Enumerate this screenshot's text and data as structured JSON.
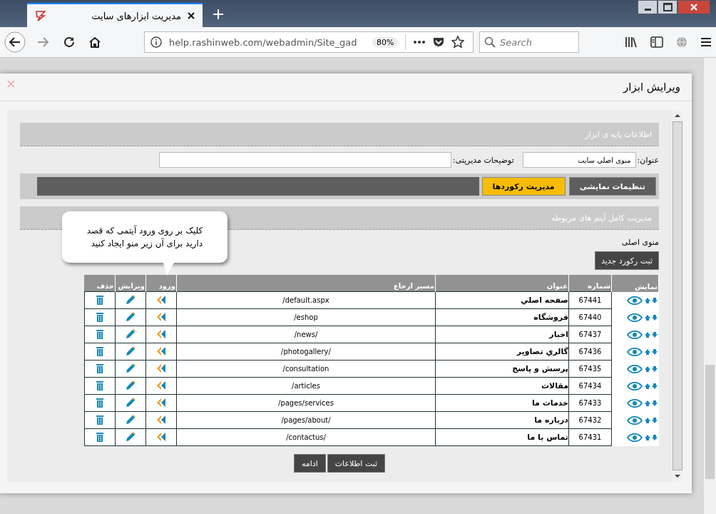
{
  "browser": {
    "tab_title": "مدیریت ابزارهای سایت",
    "url": "help.rashinweb.com/webadmin/Site_gad",
    "zoom": "80%",
    "search": {
      "placeholder": "Search"
    }
  },
  "modal": {
    "title": "ویرایش ابزار",
    "basic_section": {
      "heading": "اطلاعات پایه ی ابزار",
      "title_label": "عنوان:",
      "title_value": "منوی اصلی سایت",
      "notes_label": "توضیحات مدیریتی:"
    },
    "tabs": [
      {
        "label": "تنظیمات نمایشی",
        "selected": false
      },
      {
        "label": "مدیریت رکوردها",
        "selected": true
      }
    ],
    "items_section": {
      "heading": "مدیریت کامل آیتم های مربوطه",
      "menu_name": "منوی اصلی",
      "new_button": "ثبت رکورد جدید"
    },
    "tooltip": {
      "line_1": "کلیک بر روی ورود آیتمی  که قصد",
      "line_2": "دارید برای آن زیر منو ایجاد کنید"
    },
    "table": {
      "columns": [
        "نمایش",
        "شماره",
        "عنوان",
        "مسیر ارجاع",
        "ورود",
        "ویرایش",
        "حذف"
      ],
      "rows": [
        {
          "number": "67441",
          "title": "صفحه اصلي",
          "path": "/default.aspx"
        },
        {
          "number": "67440",
          "title": "فروشگاه",
          "path": "/eshop"
        },
        {
          "number": "67437",
          "title": "اخبار",
          "path": "/news/"
        },
        {
          "number": "67436",
          "title": "گالري تصاوير",
          "path": "/photogallery/"
        },
        {
          "number": "67435",
          "title": "پرسش و پاسخ",
          "path": "/consultation"
        },
        {
          "number": "67434",
          "title": "مقالات",
          "path": "/articles"
        },
        {
          "number": "67433",
          "title": "خدمات ما",
          "path": "/pages/services"
        },
        {
          "number": "67432",
          "title": "درباره ما",
          "path": "/pages/about/"
        },
        {
          "number": "67431",
          "title": "تماس با ما",
          "path": "/contactus/"
        }
      ]
    },
    "buttons": [
      "ثبت اطلاعات",
      "ادامه"
    ]
  }
}
